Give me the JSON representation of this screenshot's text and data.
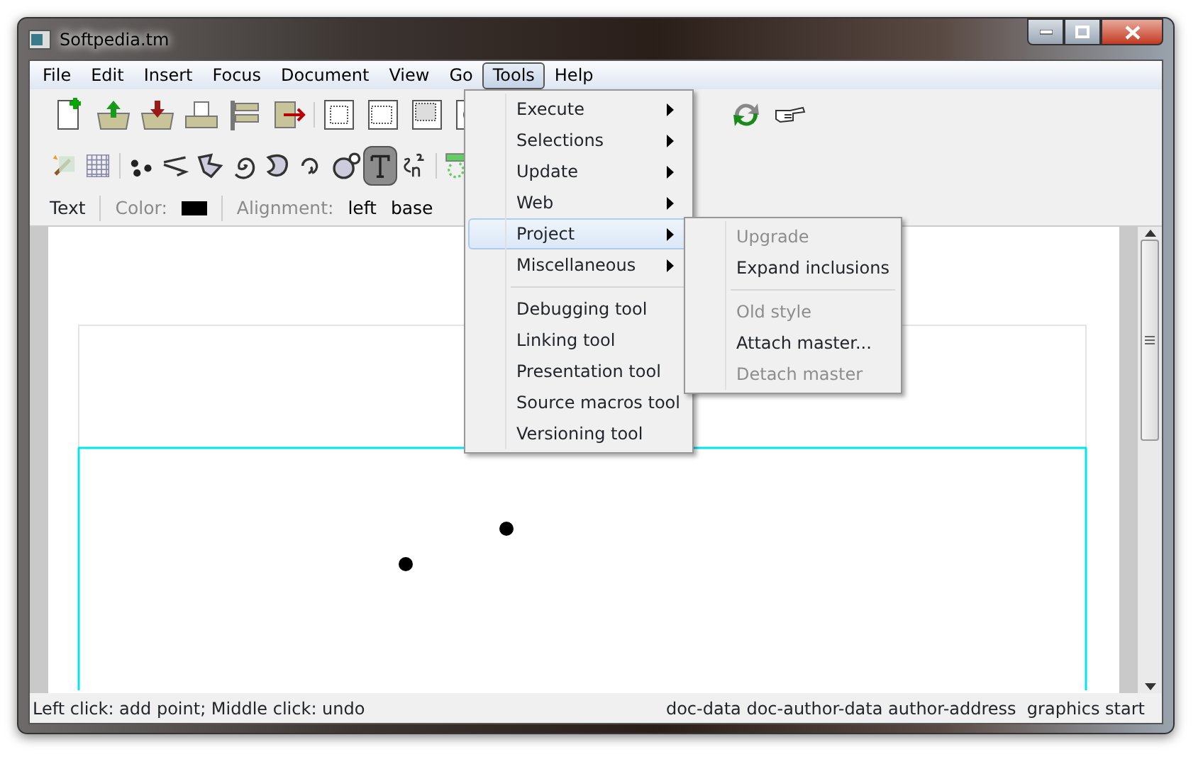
{
  "window": {
    "title": "Softpedia.tm"
  },
  "menubar": [
    {
      "label": "File",
      "selected": false
    },
    {
      "label": "Edit",
      "selected": false
    },
    {
      "label": "Insert",
      "selected": false
    },
    {
      "label": "Focus",
      "selected": false
    },
    {
      "label": "Document",
      "selected": false
    },
    {
      "label": "View",
      "selected": false
    },
    {
      "label": "Go",
      "selected": false
    },
    {
      "label": "Tools",
      "selected": true
    },
    {
      "label": "Help",
      "selected": false
    }
  ],
  "mode_tools": [
    {
      "selected": false
    },
    {
      "selected": false
    },
    {
      "selected": false
    },
    {
      "selected": false
    },
    {
      "selected": false
    },
    {
      "selected": false
    },
    {
      "selected": false
    },
    {
      "selected": false
    },
    {
      "selected": false
    },
    {
      "selected": true
    },
    {
      "selected": false
    },
    {
      "selected": false
    }
  ],
  "text_toolbar": {
    "mode": "Text",
    "color_label": "Color:",
    "color": "#000000",
    "alignment_label": "Alignment:",
    "horizontal": "left",
    "vertical": "base"
  },
  "tools_menu": [
    {
      "kind": "item",
      "label": "Execute",
      "submenu": true,
      "selected": false
    },
    {
      "kind": "item",
      "label": "Selections",
      "submenu": true,
      "selected": false
    },
    {
      "kind": "item",
      "label": "Update",
      "submenu": true,
      "selected": false
    },
    {
      "kind": "item",
      "label": "Web",
      "submenu": true,
      "selected": false
    },
    {
      "kind": "item",
      "label": "Project",
      "submenu": true,
      "selected": true
    },
    {
      "kind": "item",
      "label": "Miscellaneous",
      "submenu": true,
      "selected": false
    },
    {
      "kind": "separator"
    },
    {
      "kind": "item",
      "label": "Debugging tool",
      "submenu": false,
      "selected": false
    },
    {
      "kind": "item",
      "label": "Linking tool",
      "submenu": false,
      "selected": false
    },
    {
      "kind": "item",
      "label": "Presentation tool",
      "submenu": false,
      "selected": false
    },
    {
      "kind": "item",
      "label": "Source macros tool",
      "submenu": false,
      "selected": false
    },
    {
      "kind": "item",
      "label": "Versioning tool",
      "submenu": false,
      "selected": false
    }
  ],
  "project_submenu": [
    {
      "kind": "item",
      "label": "Upgrade",
      "disabled": true
    },
    {
      "kind": "item",
      "label": "Expand inclusions",
      "disabled": false
    },
    {
      "kind": "separator"
    },
    {
      "kind": "item",
      "label": "Old style",
      "disabled": true
    },
    {
      "kind": "item",
      "label": "Attach master...",
      "disabled": false
    },
    {
      "kind": "item",
      "label": "Detach master",
      "disabled": true
    }
  ],
  "status_bar": {
    "left": "Left click: add point; Middle click: undo",
    "right": "doc-data doc-author-data author-address  graphics start"
  }
}
